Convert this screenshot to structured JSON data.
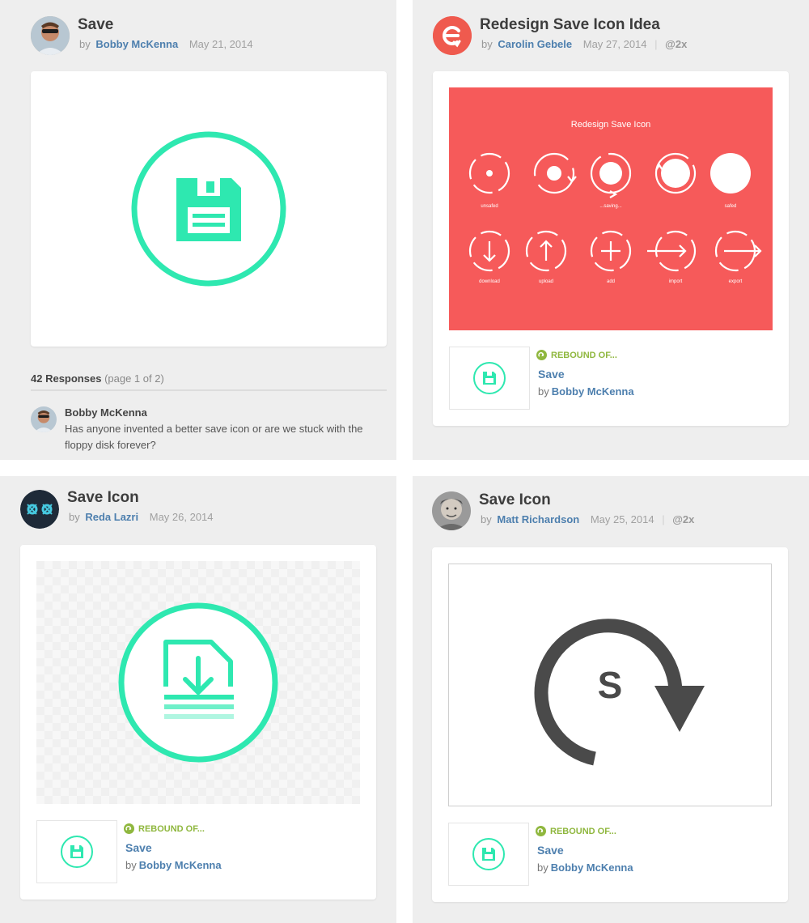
{
  "shots": [
    {
      "title": "Save",
      "by": "by",
      "author": "Bobby McKenna",
      "date": "May 21, 2014",
      "icon": "floppy-disk-in-circle",
      "responses": {
        "count": "42 Responses",
        "page": "(page 1 of 2)",
        "comments": [
          {
            "author": "Bobby McKenna",
            "text": "Has anyone invented a better save icon or are we stuck with the floppy disk forever?"
          }
        ]
      }
    },
    {
      "title": "Redesign Save Icon Idea",
      "by": "by",
      "author": "Carolin Gebele",
      "date": "May 27, 2014",
      "sep": "|",
      "resolution": "@2x",
      "artboard": {
        "heading": "Redesign Save Icon",
        "background": "#f65a5a",
        "row1_labels": [
          "unsafed",
          "...saving...",
          "safed"
        ],
        "row2_labels": [
          "download",
          "upload",
          "add",
          "import",
          "export"
        ]
      },
      "rebound": {
        "label": "REBOUND OF...",
        "title": "Save",
        "by": "by",
        "author": "Bobby McKenna"
      }
    },
    {
      "title": "Save Icon",
      "by": "by",
      "author": "Reda Lazri",
      "date": "May 26, 2014",
      "icon": "document-download-in-circle",
      "rebound": {
        "label": "REBOUND OF...",
        "title": "Save",
        "by": "by",
        "author": "Bobby McKenna"
      }
    },
    {
      "title": "Save Icon",
      "by": "by",
      "author": "Matt Richardson",
      "date": "May 25, 2014",
      "sep": "|",
      "resolution": "@2x",
      "icon_letter": "S",
      "rebound": {
        "label": "REBOUND OF...",
        "title": "Save",
        "by": "by",
        "author": "Bobby McKenna"
      }
    }
  ],
  "colors": {
    "accent_green": "#2ee8b0",
    "link_blue": "#4d7fae",
    "rebound_green": "#8fb73e",
    "dark_icon": "#4a4a4a"
  }
}
